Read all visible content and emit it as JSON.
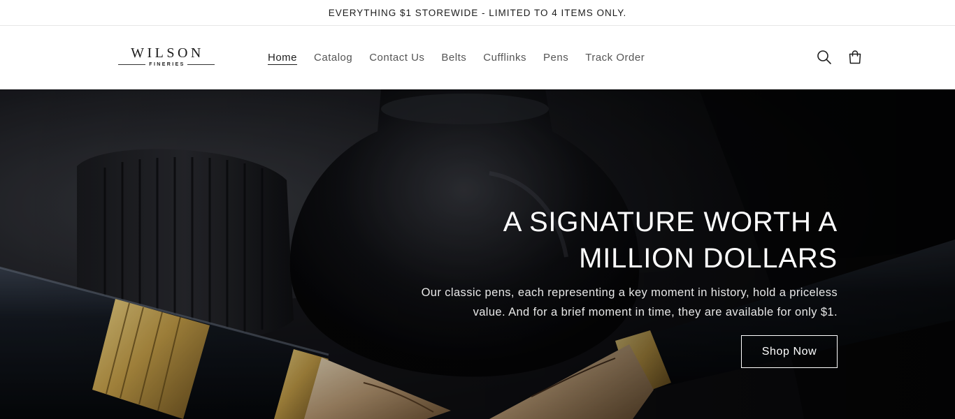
{
  "announcement": {
    "text": "EVERYTHING $1 STOREWIDE - LIMITED TO 4 ITEMS ONLY."
  },
  "brand": {
    "name": "WILSON",
    "tagline": "FINERIES"
  },
  "nav": {
    "items": [
      {
        "label": "Home",
        "active": true
      },
      {
        "label": "Catalog",
        "active": false
      },
      {
        "label": "Contact Us",
        "active": false
      },
      {
        "label": "Belts",
        "active": false
      },
      {
        "label": "Cufflinks",
        "active": false
      },
      {
        "label": "Pens",
        "active": false
      },
      {
        "label": "Track Order",
        "active": false
      }
    ]
  },
  "header_icons": {
    "search": "search-icon",
    "cart": "cart-icon"
  },
  "hero": {
    "title_line1": "A SIGNATURE WORTH A",
    "title_line2": "MILLION DOLLARS",
    "text_line1": "Our classic pens, each representing a key moment in history, hold a priceless",
    "text_line2": "value. And for a brief moment in time, they are available for only $1.",
    "button_label": "Shop Now"
  },
  "colors": {
    "text_dark": "#121212",
    "hero_bg": "#0e0f12",
    "pen_gold": "#c9a24a",
    "white": "#ffffff"
  }
}
